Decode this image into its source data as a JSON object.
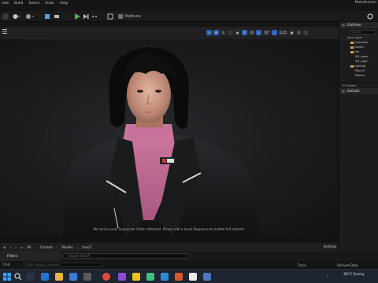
{
  "window": {
    "title": "MetaHuman"
  },
  "menubar": {
    "items": [
      "ools",
      "Build",
      "Select",
      "Actor",
      "Help"
    ]
  },
  "toolbar": {
    "platforms_label": "Platforms"
  },
  "viewport": {
    "message": "No active Level Sequencer Editor detected. Please edit a Level Sequence to enable full controls.",
    "grid_snap": "10",
    "rotate_snap": "10°",
    "scale_snap": "0.25",
    "camera_speed": "4"
  },
  "outliner": {
    "title": "Outliner",
    "search_placeholder": "Search",
    "column_header": "Item Label",
    "tree": [
      {
        "label": "Cinematic",
        "folder": true,
        "indent": 1
      },
      {
        "label": "Gentel",
        "folder": true,
        "indent": 1
      },
      {
        "label": "Hm",
        "folder": true,
        "indent": 1
      },
      {
        "label": "SM_Lamp",
        "folder": false,
        "indent": 2
      },
      {
        "label": "SM_Light",
        "folder": false,
        "indent": 2
      },
      {
        "label": "Lighting",
        "folder": true,
        "indent": 1
      },
      {
        "label": "Plane3",
        "folder": false,
        "indent": 2
      },
      {
        "label": "Plane4",
        "folder": false,
        "indent": 2
      }
    ],
    "actor_count": "25 actors"
  },
  "details": {
    "title": "Details"
  },
  "content_browser": {
    "breadcrumb": [
      "All",
      "Content",
      "Models",
      "zhaoT"
    ],
    "settings_label": "Settings",
    "filters_label": "Filters",
    "search_placeholder": "Search zhaoT"
  },
  "statusbar": {
    "cmd_label": "Cmd",
    "cmd_placeholder": "Enter Console Command",
    "trace_label": "Trace",
    "derived_label": "Derived Data"
  },
  "taskbar": {
    "weather": "30°C  Sunny"
  },
  "colors": {
    "accent": "#2a5fb0",
    "folder": "#c9a35a",
    "play": "#4caf50"
  }
}
